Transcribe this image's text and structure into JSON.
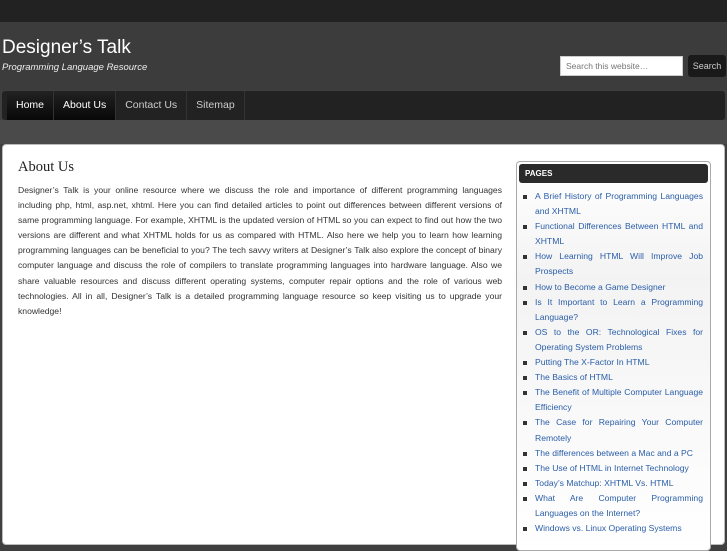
{
  "header": {
    "title": "Designer’s Talk",
    "tagline": "Programming Language Resource",
    "search_placeholder": "Search this website…",
    "search_button": "Search"
  },
  "nav": [
    "Home",
    "About Us",
    "Contact Us",
    "Sitemap"
  ],
  "main": {
    "title": "About Us",
    "body": "Designer’s Talk is your online resource where we discuss the role and importance of different programming languages including php, html, asp.net, xhtml. Here you can find detailed articles to point out differences between different versions of same programming language. For example, XHTML is the updated version of HTML so you can expect to find out how the two versions are different and what XHTML holds for us as compared with HTML. Also here we help you to learn how learning programming languages can be beneficial to you? The tech savvy writers at Designer’s Talk also explore the concept of binary computer language and discuss the role of compilers to translate programming languages into hardware language. Also we share valuable resources and discuss different operating systems, computer repair options and the role of various web technologies. All in all, Designer’s Talk is a detailed programming language resource so keep visiting us to upgrade your knowledge!"
  },
  "sidebar": {
    "heading": "PAGES",
    "items": [
      "A Brief History of Programming Languages and XHTML",
      "Functional Differences Between HTML and XHTML",
      "How Learning HTML Will Improve Job Prospects",
      "How to Become a Game Designer",
      "Is It Important to Learn a Programming Language?",
      "OS to the OR: Technological Fixes for Operating System Problems",
      "Putting The X-Factor In HTML",
      "The Basics of HTML",
      "The Benefit of Multiple Computer Language Efficiency",
      "The Case for Repairing Your Computer Remotely",
      "The differences between a Mac and a PC",
      "The Use of HTML in Internet Technology",
      "Today’s Matchup: XHTML Vs. HTML",
      "What Are Computer Programming Languages on the Internet?",
      "Windows vs. Linux Operating Systems"
    ]
  }
}
